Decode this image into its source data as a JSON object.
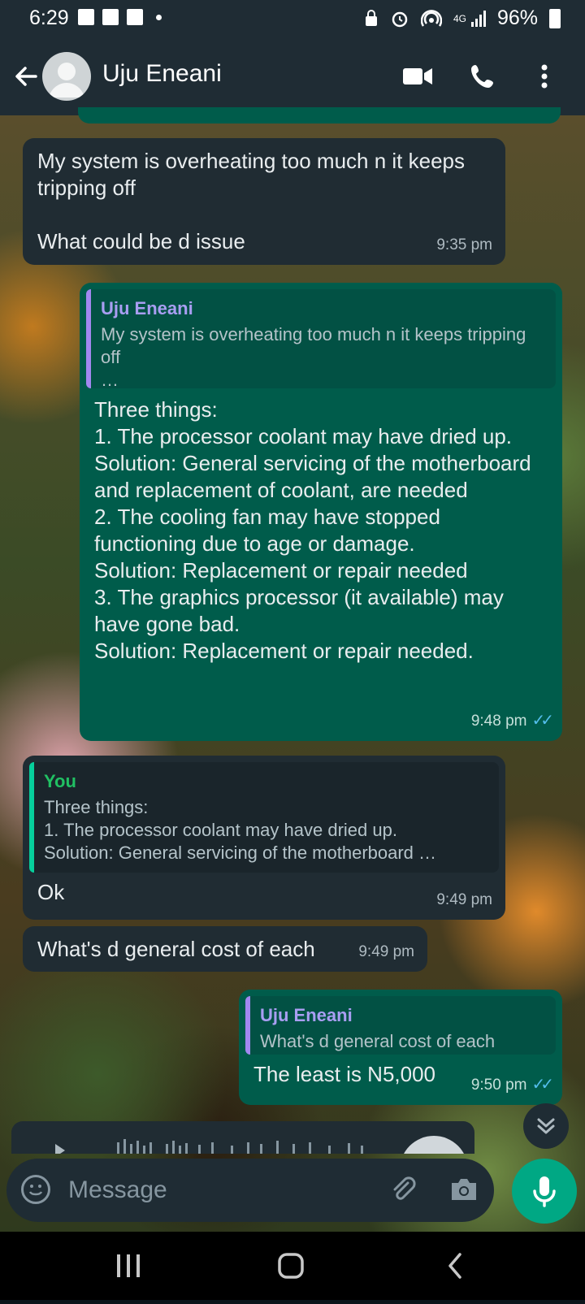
{
  "status": {
    "time": "6:29",
    "battery": "96%"
  },
  "header": {
    "contact_name": "Uju Eneani"
  },
  "messages": {
    "m1": {
      "text": "My system is overheating too much n it keeps tripping off\n\nWhat could be d issue",
      "time": "9:35 pm"
    },
    "m2": {
      "quote_author": "Uju Eneani",
      "quote_text": "My system is overheating too much n it keeps tripping off\n…",
      "text": "Three things:\n1. The processor coolant may have dried up.\nSolution: General servicing of the motherboard and replacement of coolant, are needed\n2. The cooling fan may have stopped functioning due to age or damage.\nSolution: Replacement or repair needed\n3. The graphics processor (it available) may have gone bad.\nSolution: Replacement or repair needed.",
      "time": "9:48 pm"
    },
    "m3": {
      "quote_author": "You",
      "quote_text": "Three things:\n1. The processor coolant may have dried up.\nSolution: General servicing of the motherboard …",
      "text": "Ok",
      "time": "9:49 pm"
    },
    "m4": {
      "text": "What's d general cost of each",
      "time": "9:49 pm"
    },
    "m5": {
      "quote_author": "Uju Eneani",
      "quote_text": "What's d general cost of each",
      "text": "The least is N5,000",
      "time": "9:50 pm"
    }
  },
  "composer": {
    "placeholder": "Message"
  },
  "colors": {
    "incoming": "#202c33",
    "outgoing": "#005c4b",
    "accent": "#00a884"
  }
}
